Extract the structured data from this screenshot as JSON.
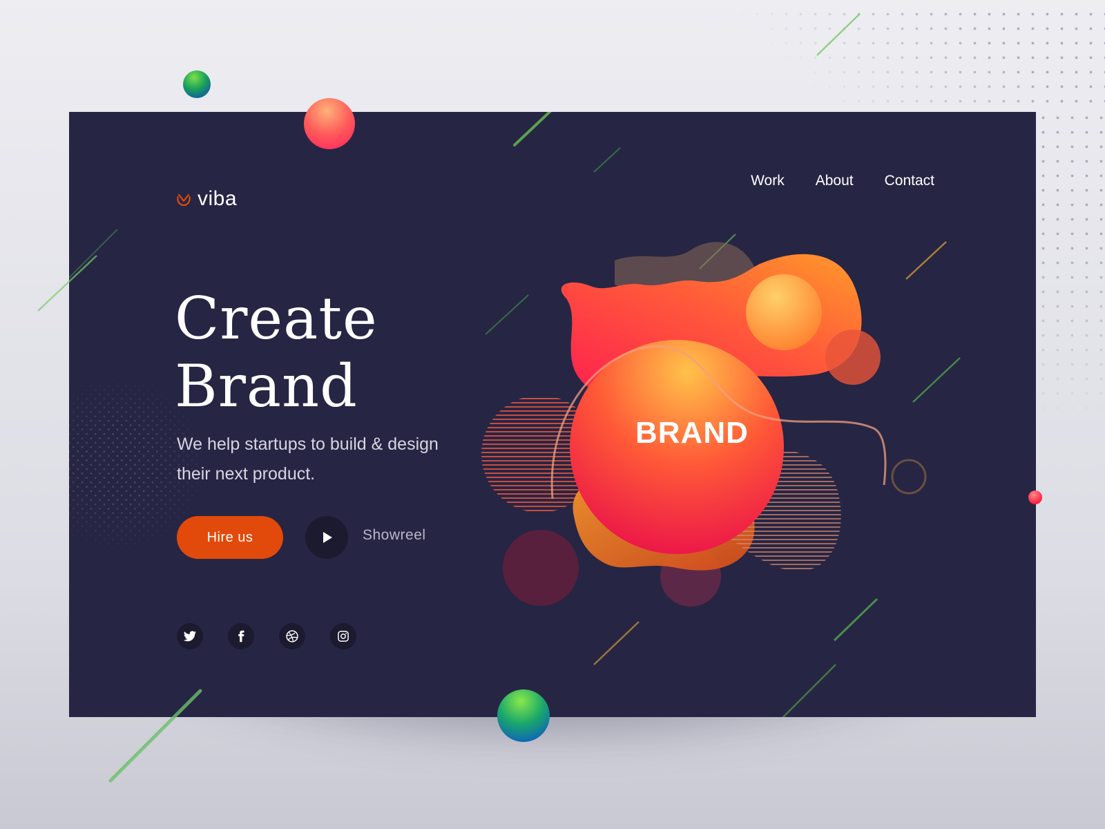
{
  "brand": {
    "name": "viba"
  },
  "nav": {
    "items": [
      {
        "label": "Work"
      },
      {
        "label": "About"
      },
      {
        "label": "Contact"
      }
    ]
  },
  "hero": {
    "headline_line1": "Create",
    "headline_line2": "Brand",
    "subtitle": "We help startups to build & design their next product.",
    "primary_cta": "Hire us",
    "secondary_cta": "Showreel",
    "art_label": "BRAND"
  },
  "social": {
    "icons": [
      "twitter-icon",
      "facebook-icon",
      "dribbble-icon",
      "instagram-icon"
    ]
  },
  "colors": {
    "card_background": "#272544",
    "accent": "#e14a0a",
    "page_background": "#e4e4ea"
  }
}
